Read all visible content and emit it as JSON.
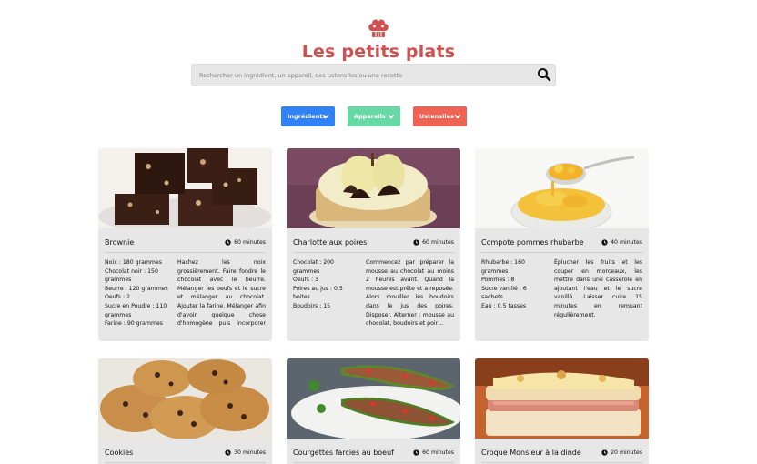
{
  "header": {
    "title": "Les petits plats",
    "logo_icon": "chef-hat-icon"
  },
  "search": {
    "placeholder": "Rechercher un ingrédient, un appareil, des ustensiles ou une recette",
    "icon": "search-icon"
  },
  "filters": [
    {
      "label": "Ingrédients",
      "color": "#3282F7"
    },
    {
      "label": "Appareils",
      "color": "#68D9A4"
    },
    {
      "label": "Ustensiles",
      "color": "#ED6454"
    }
  ],
  "colors": {
    "brand": "#D04F4F",
    "card_bg": "#E7E7E7"
  },
  "recipes": [
    {
      "name": "Brownie",
      "time": "60 minutes",
      "ingredients": [
        {
          "name": "Noix",
          "qty": "180 grammes"
        },
        {
          "name": "Chocolat noir",
          "qty": "150 grammes"
        },
        {
          "name": "Beurre",
          "qty": "120 grammes"
        },
        {
          "name": "Oeufs",
          "qty": "2"
        },
        {
          "name": "Sucre en Poudre",
          "qty": "110 grammes"
        },
        {
          "name": "Farine",
          "qty": "90 grammes"
        }
      ],
      "description": "Hachez les noix grossièrement. Faire fondre le chocolat avec le beurre. Mélanger les oeufs et le sucre et mélanger au chocolat. Ajouter la farine. Mélanger afin d'avoir quelque chose d'homogène puis incorporer les noix. Verser …"
    },
    {
      "name": "Charlotte aux poires",
      "time": "60 minutes",
      "ingredients": [
        {
          "name": "Chocolat",
          "qty": "200 grammes"
        },
        {
          "name": "Oeufs",
          "qty": "3"
        },
        {
          "name": "Poires au jus",
          "qty": "0.5 boites"
        },
        {
          "name": "Boudoirs",
          "qty": "15"
        }
      ],
      "description": "Commencez par préparer la mousse au chocolat au moins 2 heures avant. Quand la mousse est prête et a reposée. Alors mouiller les boudoirs dans le jus des poires. Disposer. Alterner : mousse au chocolat, boudoirs et poir…"
    },
    {
      "name": "Compote pommes rhubarbe",
      "time": "40 minutes",
      "ingredients": [
        {
          "name": "Rhubarbe",
          "qty": "160 grammes"
        },
        {
          "name": "Pommes",
          "qty": "8"
        },
        {
          "name": "Sucre vanillé",
          "qty": "6 sachets"
        },
        {
          "name": "Eau",
          "qty": "0.5 tasses"
        }
      ],
      "description": "Éplucher les fruits et les couper en morceaux, les mettre dans une casserole en ajoutant l'eau et le sucre vanillé. Laisser cuire 15 minutes en remuant régulièrement."
    },
    {
      "name": "Cookies",
      "time": "30 minutes",
      "ingredients": [],
      "description": ""
    },
    {
      "name": "Courgettes farcies au boeuf",
      "time": "60 minutes",
      "ingredients": [],
      "description": ""
    },
    {
      "name": "Croque Monsieur à la dinde",
      "time": "20 minutes",
      "ingredients": [],
      "description": ""
    }
  ]
}
